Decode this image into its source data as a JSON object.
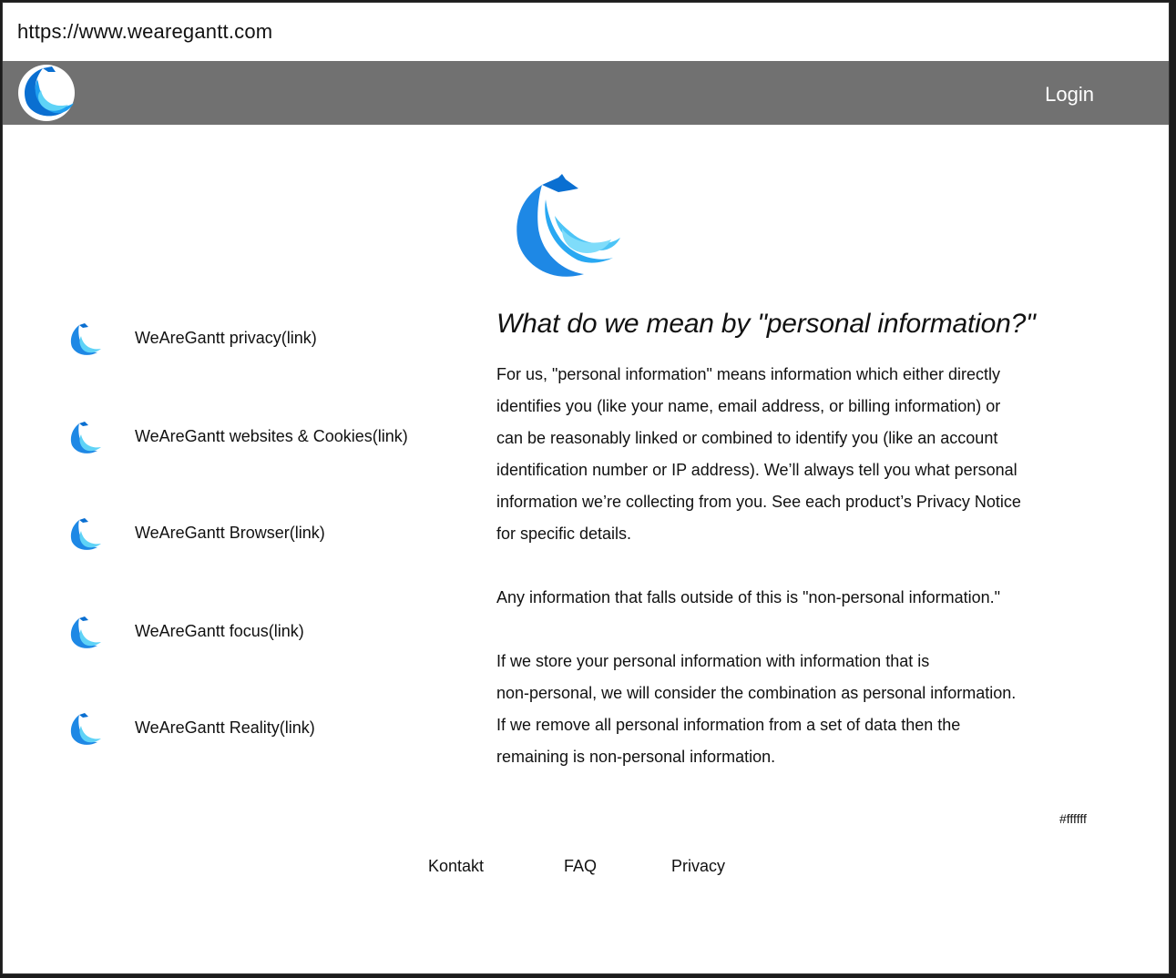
{
  "browser": {
    "url": "https://www.wearegantt.com"
  },
  "navbar": {
    "logo_icon": "eagle-wave-logo-icon",
    "login_label": "Login",
    "background_color": "#717171"
  },
  "hero": {
    "logo_icon": "eagle-wave-logo-icon"
  },
  "sidebar": {
    "items": [
      {
        "label": "WeAreGantt privacy(link)",
        "icon": "eagle-wave-logo-icon"
      },
      {
        "label": "WeAreGantt websites & Cookies(link)",
        "icon": "eagle-wave-logo-icon"
      },
      {
        "label": "WeAreGantt Browser(link)",
        "icon": "eagle-wave-logo-icon"
      },
      {
        "label": "WeAreGantt focus(link)",
        "icon": "eagle-wave-logo-icon"
      },
      {
        "label": "WeAreGantt Reality(link)",
        "icon": "eagle-wave-logo-icon"
      }
    ]
  },
  "main": {
    "heading": "What do we mean by \"personal information?\"",
    "paragraph1_lines": [
      "For us, \"personal information\" means information which either directly",
      "identifies you (like your name, email address, or billing information) or",
      "can be reasonably linked or combined to identify you (like an account",
      "identification number or IP address). We’ll always tell you what personal",
      "information we’re collecting from you. See each product’s Privacy Notice",
      "for specific details."
    ],
    "paragraph2": "Any information that falls outside of this is \"non-personal information.\"",
    "paragraph3_lines": [
      "If we store your personal information with information that is",
      "non-personal, we will consider the combination as personal information.",
      "If we remove all personal information from a set of data then the",
      "remaining is non-personal information."
    ]
  },
  "background_color_label": "#ffffff",
  "footer": {
    "links": [
      "Kontakt",
      "FAQ",
      "Privacy"
    ]
  },
  "colors": {
    "logo_dark": "#0a6fd1",
    "logo_mid": "#1e9ef0",
    "logo_light": "#5fd3f7"
  }
}
